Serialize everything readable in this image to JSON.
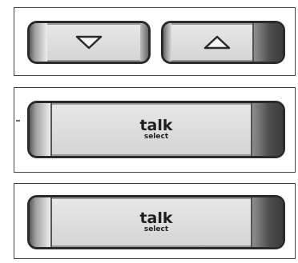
{
  "nav_buttons": {
    "down_icon": "triangle-down-icon",
    "up_icon": "triangle-up-icon"
  },
  "talk_buttons": [
    {
      "title": "talk",
      "subtitle": "select"
    },
    {
      "title": "talk",
      "subtitle": "select"
    }
  ],
  "colors": {
    "button_face": "#dcdcdc",
    "button_border": "#2a2a2a",
    "panel_border": "#444444",
    "text": "#1e1e1e"
  }
}
